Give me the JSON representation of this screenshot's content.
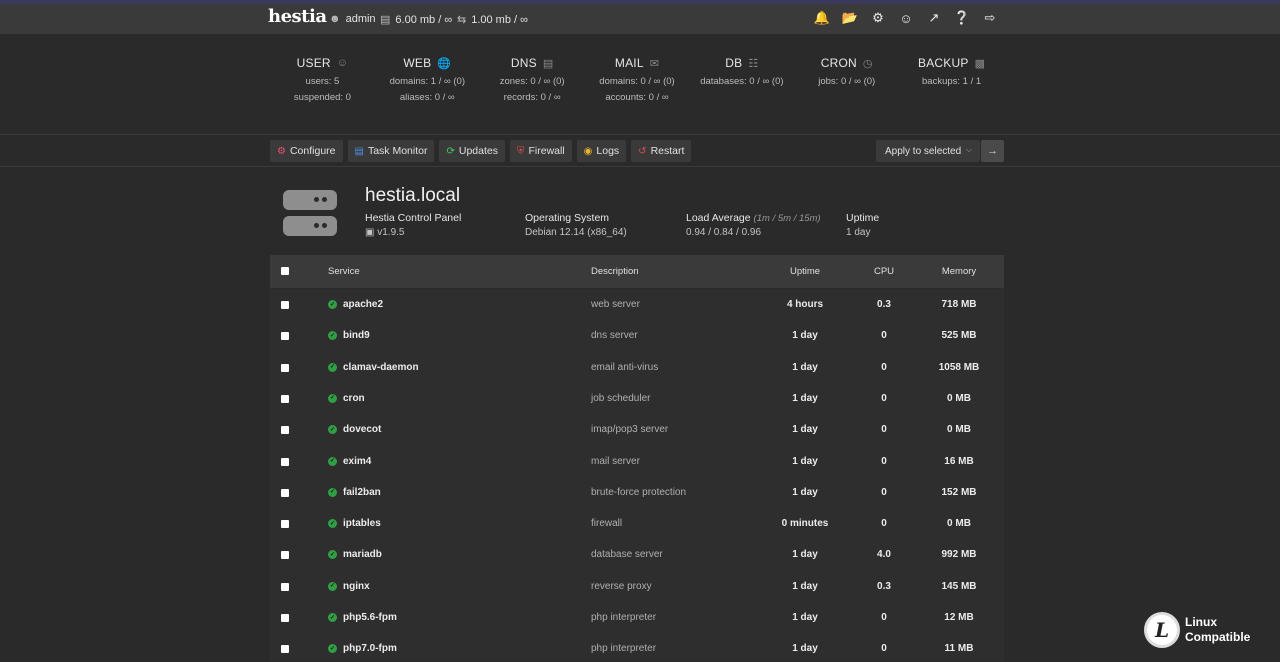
{
  "topbar": {
    "logo": "hestia",
    "user": "admin",
    "disk": "6.00 mb / ∞",
    "bandwidth": "1.00 mb / ∞",
    "icons": [
      "bell-icon",
      "folder-icon",
      "gear-icon",
      "user-circle-icon",
      "chart-icon",
      "help-icon",
      "logout-icon"
    ]
  },
  "stats": [
    {
      "title": "USER",
      "icon": "users-icon",
      "line1": "users: 5",
      "line2": "suspended: 0"
    },
    {
      "title": "WEB",
      "icon": "globe-icon",
      "line1": "domains: 1 / ∞ (0)",
      "line2": "aliases: 0 / ∞"
    },
    {
      "title": "DNS",
      "icon": "book-icon",
      "line1": "zones: 0 / ∞ (0)",
      "line2": "records: 0 / ∞"
    },
    {
      "title": "MAIL",
      "icon": "mail-icon",
      "line1": "domains: 0 / ∞ (0)",
      "line2": "accounts: 0 / ∞"
    },
    {
      "title": "DB",
      "icon": "database-icon",
      "line1": "databases: 0 / ∞ (0)",
      "line2": ""
    },
    {
      "title": "CRON",
      "icon": "clock-icon",
      "line1": "jobs: 0 / ∞ (0)",
      "line2": ""
    },
    {
      "title": "BACKUP",
      "icon": "file-icon",
      "line1": "backups: 1 / 1",
      "line2": ""
    }
  ],
  "toolbar": {
    "configure": "Configure",
    "task_monitor": "Task Monitor",
    "updates": "Updates",
    "firewall": "Firewall",
    "logs": "Logs",
    "restart": "Restart",
    "apply_selected": "Apply to selected",
    "apply_go": "→"
  },
  "server": {
    "hostname": "hestia.local",
    "panel_label": "Hestia Control Panel",
    "panel_version": "v1.9.5",
    "os_label": "Operating System",
    "os_value": "Debian 12.14 (x86_64)",
    "load_label": "Load Average",
    "load_hint": "(1m / 5m / 15m)",
    "load_value": "0.94 / 0.84 / 0.96",
    "uptime_label": "Uptime",
    "uptime_value": "1 day"
  },
  "table": {
    "headers": {
      "service": "Service",
      "description": "Description",
      "uptime": "Uptime",
      "cpu": "CPU",
      "memory": "Memory"
    },
    "rows": [
      {
        "service": "apache2",
        "description": "web server",
        "uptime": "4 hours",
        "cpu": "0.3",
        "memory": "718 MB"
      },
      {
        "service": "bind9",
        "description": "dns server",
        "uptime": "1 day",
        "cpu": "0",
        "memory": "525 MB"
      },
      {
        "service": "clamav-daemon",
        "description": "email anti-virus",
        "uptime": "1 day",
        "cpu": "0",
        "memory": "1058 MB"
      },
      {
        "service": "cron",
        "description": "job scheduler",
        "uptime": "1 day",
        "cpu": "0",
        "memory": "0 MB"
      },
      {
        "service": "dovecot",
        "description": "imap/pop3 server",
        "uptime": "1 day",
        "cpu": "0",
        "memory": "0 MB"
      },
      {
        "service": "exim4",
        "description": "mail server",
        "uptime": "1 day",
        "cpu": "0",
        "memory": "16 MB"
      },
      {
        "service": "fail2ban",
        "description": "brute-force protection",
        "uptime": "1 day",
        "cpu": "0",
        "memory": "152 MB"
      },
      {
        "service": "iptables",
        "description": "firewall",
        "uptime": "0 minutes",
        "cpu": "0",
        "memory": "0 MB"
      },
      {
        "service": "mariadb",
        "description": "database server",
        "uptime": "1 day",
        "cpu": "4.0",
        "memory": "992 MB"
      },
      {
        "service": "nginx",
        "description": "reverse proxy",
        "uptime": "1 day",
        "cpu": "0.3",
        "memory": "145 MB"
      },
      {
        "service": "php5.6-fpm",
        "description": "php interpreter",
        "uptime": "1 day",
        "cpu": "0",
        "memory": "12 MB"
      },
      {
        "service": "php7.0-fpm",
        "description": "php interpreter",
        "uptime": "1 day",
        "cpu": "0",
        "memory": "11 MB"
      }
    ]
  },
  "watermark": {
    "line1": "Linux",
    "line2": "Compatible"
  },
  "colors": {
    "status_ok": "#2ea043",
    "configure_icon": "#e8506a",
    "updates_icon": "#3ccf63",
    "firewall_icon": "#e04b4b",
    "logs_icon": "#f0b429",
    "restart_icon": "#e04b4b",
    "task_icon": "#4a90e2"
  }
}
